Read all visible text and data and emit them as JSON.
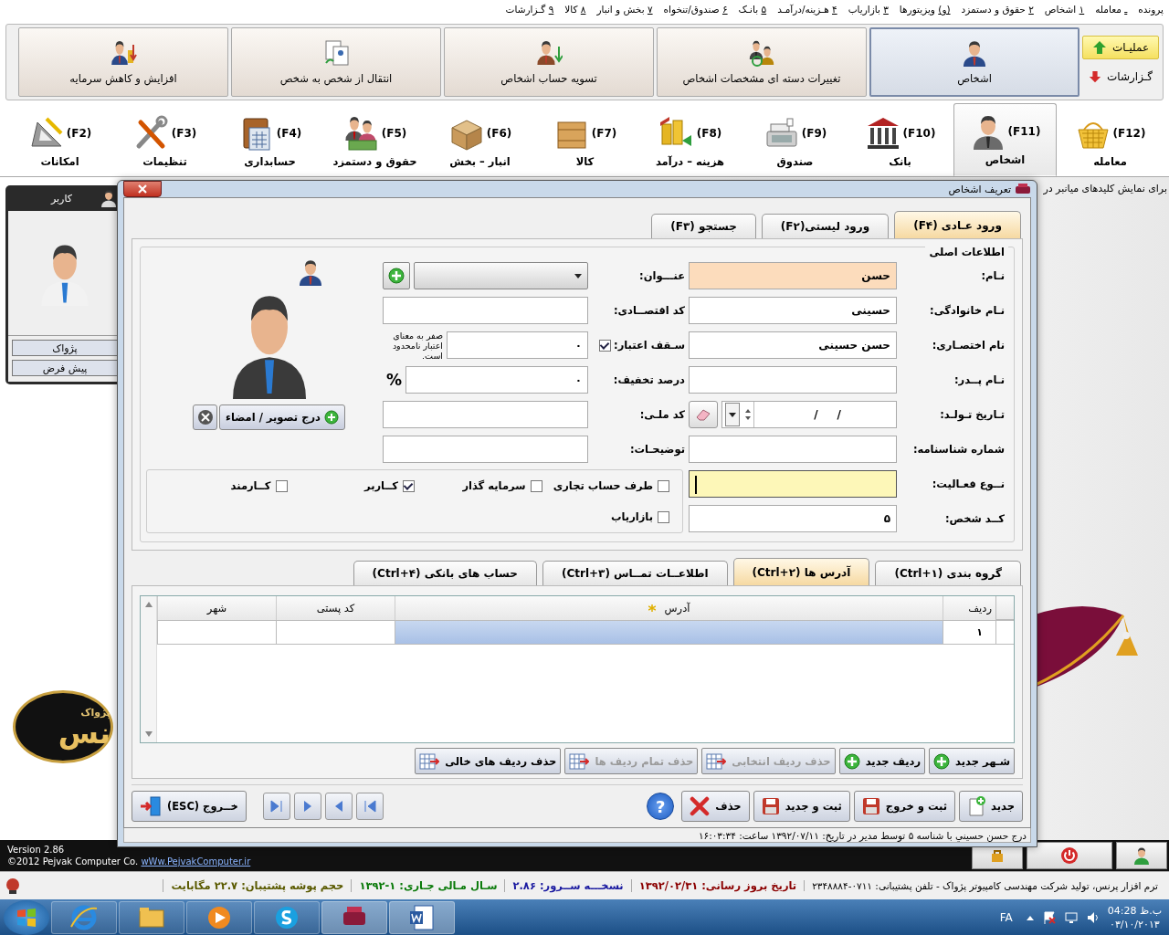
{
  "menu_bar": [
    {
      "label": "پرونده"
    },
    {
      "key": "ـ",
      "label": "معامله"
    },
    {
      "key": "۱",
      "label": "اشخاص"
    },
    {
      "key": "۲",
      "label": "حقوق و دستمزد"
    },
    {
      "key": "(و)",
      "label": "ویزیتورها"
    },
    {
      "key": "۳",
      "label": "بازاریاب"
    },
    {
      "key": "۴",
      "label": "هـزینه/درآمـد"
    },
    {
      "key": "۵",
      "label": "بانـک"
    },
    {
      "key": "۶",
      "label": "صندوق/تنخواه"
    },
    {
      "key": "۷",
      "label": "بخش و انبار"
    },
    {
      "key": "۸",
      "label": "کالا"
    },
    {
      "key": "۹",
      "label": "گـزارشات"
    }
  ],
  "mode_switch": [
    {
      "label": "عملیـات",
      "selected": true
    },
    {
      "label": "گـزارشات",
      "selected": false
    }
  ],
  "operation_tiles": [
    {
      "label": "اشخاص",
      "selected": true
    },
    {
      "label": "تغییرات دسته ای مشخصات اشخاص",
      "selected": false
    },
    {
      "label": "تسویه حساب اشخاص",
      "selected": false
    },
    {
      "label": "انتقال از شخص به شخص",
      "selected": false
    },
    {
      "label": "افزایش و کاهش سرمایه",
      "selected": false
    }
  ],
  "module_tabs": [
    {
      "label": "معامله",
      "key": "(F12)",
      "selected": false
    },
    {
      "label": "اشخاص",
      "key": "(F11)",
      "selected": true
    },
    {
      "label": "بانک",
      "key": "(F10)",
      "selected": false
    },
    {
      "label": "صندوق",
      "key": "(F9)",
      "selected": false
    },
    {
      "label": "هزینه – درآمد",
      "key": "(F8)",
      "selected": false
    },
    {
      "label": "کالا",
      "key": "(F7)",
      "selected": false
    },
    {
      "label": "انبار – بخش",
      "key": "(F6)",
      "selected": false
    },
    {
      "label": "حقوق و دستمزد",
      "key": "(F5)",
      "selected": false
    },
    {
      "label": "حسابداری",
      "key": "(F4)",
      "selected": false
    },
    {
      "label": "تنظیمات",
      "key": "(F3)",
      "selected": false
    },
    {
      "label": "امکانات",
      "key": "(F2)",
      "selected": false
    }
  ],
  "user_panel": {
    "title": "کاربر",
    "buttons": [
      "پژواک",
      "پیش فرض"
    ]
  },
  "hint_text": "برای نمایش کلیدهای میانبر در",
  "logo": {
    "caption": "پژواک",
    "wordmark": "نس"
  },
  "dialog": {
    "title": "تعریف اشخاص",
    "tabs": [
      {
        "label": "ورود عـادی (F۴)",
        "selected": true
      },
      {
        "label": "ورود لیستی(F۲)",
        "selected": false
      },
      {
        "label": "جستجو (F۳)",
        "selected": false
      }
    ],
    "group_title": "اطلاعات اصلی",
    "fields_right": [
      {
        "label": "نـام:",
        "kind": "text",
        "value": "حسن",
        "required": true,
        "focused": false
      },
      {
        "label": "نـام خانوادگی:",
        "kind": "text",
        "value": "حسینی",
        "required": false,
        "focused": false
      },
      {
        "label": "نام اختصـاری:",
        "kind": "text",
        "value": "حسن حسینی",
        "required": false,
        "focused": false
      },
      {
        "label": "نـام پــدر:",
        "kind": "text",
        "required": false,
        "focused": false
      },
      {
        "label": "تـاریخ تـولـد:",
        "kind": "date",
        "value": "/     /",
        "required": false,
        "focused": false
      },
      {
        "label": "شماره شناسنامه:",
        "kind": "text",
        "required": false,
        "focused": false
      },
      {
        "label": "نــوع فعـالیت:",
        "kind": "text",
        "required": false,
        "focused": true
      },
      {
        "label": "کــد شخص:",
        "kind": "text",
        "value": "۵",
        "required": false,
        "focused": false
      }
    ],
    "fields_middle": [
      {
        "label": "عنـــوان:",
        "kind": "select"
      },
      {
        "label": "کد اقتصــادی:",
        "kind": "text"
      },
      {
        "label": "سـقف اعتبار:",
        "kind": "credit",
        "checked": true,
        "value": "۰",
        "note": "صفر به معنای اعتبار نامحدود است."
      },
      {
        "label": "درصد تخفیف:",
        "kind": "percent",
        "value": "۰",
        "unit": "%"
      },
      {
        "label": "کد ملـی:",
        "kind": "text"
      },
      {
        "label": "توضیحـات:",
        "kind": "text"
      }
    ],
    "photo_button": "درج تصویر / امضاء",
    "roles": [
      {
        "label": "طرف حساب تجاری",
        "checked": false
      },
      {
        "label": "سرمایه گذار",
        "checked": false
      },
      {
        "label": "کــاربر",
        "checked": true
      },
      {
        "label": "کــارمند",
        "checked": false
      },
      {
        "label": "بازاریاب",
        "checked": false
      }
    ],
    "sub_tabs": [
      {
        "label": "گروه بندی (Ctrl+۱)",
        "selected": false
      },
      {
        "label": "آدرس ها (Ctrl+۲)",
        "selected": true
      },
      {
        "label": "اطلاعــات تمــاس  (Ctrl+۳)",
        "selected": false
      },
      {
        "label": "حساب های بانکی (Ctrl+۴)",
        "selected": false
      }
    ],
    "table": {
      "columns": [
        {
          "label": "ردیف",
          "required": false
        },
        {
          "label": "آدرس",
          "required": true
        },
        {
          "label": "کد پستی",
          "required": false
        },
        {
          "label": "شهر",
          "required": false
        }
      ],
      "rows": [
        {
          "row_number": "۱",
          "selected": true
        }
      ]
    },
    "grid_buttons": [
      {
        "label": "شـهر جدید",
        "kind": "add",
        "disabled": false
      },
      {
        "label": "ردیف جدید",
        "kind": "add",
        "disabled": false
      },
      {
        "label": "حذف ردیف انتخابی",
        "kind": "remove",
        "disabled": true
      },
      {
        "label": "حذف تمام ردیف ها",
        "kind": "remove",
        "disabled": true
      },
      {
        "label": "حذف ردیف های خالی",
        "kind": "remove",
        "disabled": false
      }
    ],
    "action_buttons": [
      {
        "label": "جدید",
        "kind": "new"
      },
      {
        "label": "ثبت و خروج",
        "kind": "save"
      },
      {
        "label": "ثبت و جدید",
        "kind": "save"
      },
      {
        "label": "حذف",
        "kind": "delete"
      }
    ],
    "help_button": "?",
    "exit_button": "خــروج (ESC)",
    "status": "درج حسن حسيني با شناسه ۵ توسط مدير در تاريخ: ۱۳۹۲/۰۷/۱۱ ساعت: ۱۶:۰۳:۳۴"
  },
  "footer": {
    "version": "Version 2.86",
    "copyright": "©2012 Pejvak Computer Co.",
    "link": "wWw.PejvakComputer.ir"
  },
  "status_bar": [
    {
      "text": "ترم افزار پرنس، تولید شرکت مهندسی کامپیوتر پژواک - تلفن پشتیبانی: ۰۷۱۱-۲۳۴۸۸۸۴",
      "color": "#000000"
    },
    {
      "text": "تاریخ بروز رسانی: ۱۳۹۲/۰۲/۳۱",
      "color": "#8b0000"
    },
    {
      "text": "نسخـــه ســرور: ۲.۸۶",
      "color": "#1a1aa0"
    },
    {
      "text": "سـال مـالی جـاری: ۱-۱۳۹۲",
      "color": "#0a7a0a"
    },
    {
      "text": "حجم پوشه پشتیبان: ۲۲.۷ مگابایت",
      "color": "#5a5a00"
    }
  ],
  "taskbar": {
    "language": "FA",
    "time": "ب.ظ 04:28",
    "date": "۰۳/۱۰/۲۰۱۳"
  }
}
